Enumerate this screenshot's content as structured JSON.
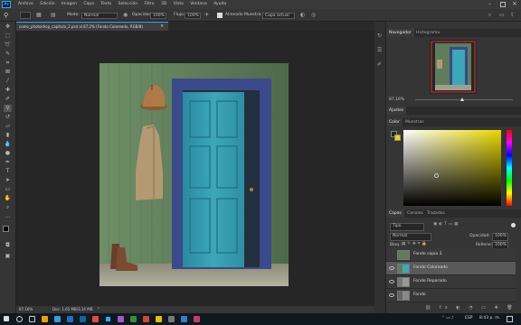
{
  "app": {
    "menu": [
      "Archivo",
      "Edición",
      "Imagen",
      "Capa",
      "Texto",
      "Selección",
      "Filtro",
      "3D",
      "Vista",
      "Ventana",
      "Ayuda"
    ],
    "logo": "Ps"
  },
  "options": {
    "mode_label": "Modo:",
    "mode_value": "Normal",
    "opacity_label": "Opacidad:",
    "opacity_value": "100%",
    "flow_label": "Flujo:",
    "flow_value": "100%",
    "aligned_label": "Alineado",
    "sample_label": "Muestra:",
    "sample_value": "Capa actual"
  },
  "document": {
    "tab_title": "como_photoshop_capitulo_2.psd al 87,2% (Fondo Coloreado, RGB/8)",
    "zoom": "87,16%",
    "doc_info": "Doc: 1,65 MB/3,14 MB"
  },
  "navigator": {
    "tabs": [
      "Navegador",
      "Histograma"
    ],
    "zoom": "87,16%"
  },
  "adjust": {
    "tab": "Ajustes"
  },
  "color": {
    "tabs": [
      "Color",
      "Muestras"
    ],
    "field_hue_color": "#e8d800"
  },
  "layers": {
    "tabs": [
      "Capas",
      "Canales",
      "Trazados"
    ],
    "kind_label": "Tipo",
    "blend_mode": "Normal",
    "opacity_label": "Opacidad:",
    "opacity_value": "100%",
    "lock_label": "Bloq.:",
    "fill_label": "Relleno:",
    "fill_value": "100%",
    "items": [
      {
        "name": "Fondo copia 3",
        "visible": false,
        "selected": false
      },
      {
        "name": "Fondo Coloreado",
        "visible": true,
        "selected": true
      },
      {
        "name": "Fondo Reparado",
        "visible": true,
        "selected": false
      },
      {
        "name": "Fondo",
        "visible": true,
        "selected": false
      }
    ]
  },
  "taskbar": {
    "language": "ESP",
    "time": "8:43 p. m."
  }
}
